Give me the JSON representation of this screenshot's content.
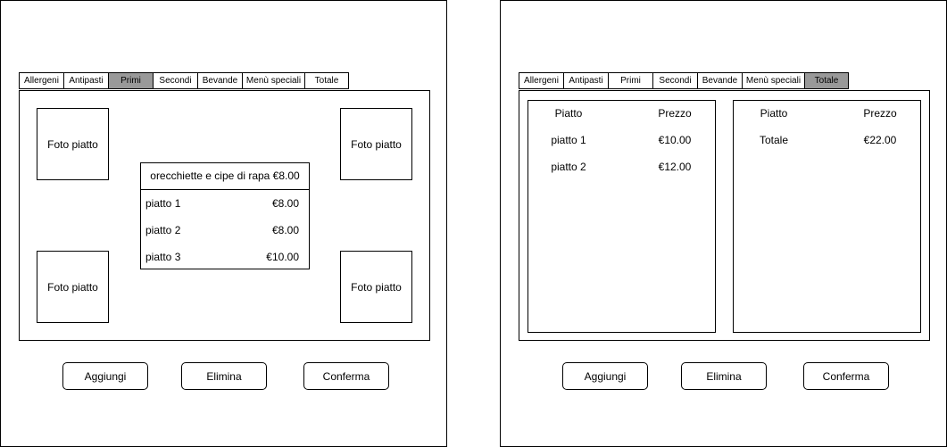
{
  "tabs": [
    "Allergeni",
    "Antipasti",
    "Primi",
    "Secondi",
    "Bevande",
    "Menù speciali",
    "Totale"
  ],
  "left_screen": {
    "active_tab": "Primi",
    "photo_label": "Foto piatto",
    "dish_header": "orecchiette e cipe di rapa €8.00",
    "dishes": [
      {
        "name": "piatto 1",
        "price": "€8.00"
      },
      {
        "name": "piatto 2",
        "price": "€8.00"
      },
      {
        "name": "piatto 3",
        "price": "€10.00"
      }
    ]
  },
  "right_screen": {
    "active_tab": "Totale",
    "order_list": {
      "col_dish": "Piatto",
      "col_price": "Prezzo",
      "rows": [
        {
          "name": "piatto 1",
          "price": "€10.00"
        },
        {
          "name": "piatto 2",
          "price": "€12.00"
        }
      ]
    },
    "total_box": {
      "col_dish": "Piatto",
      "col_price": "Prezzo",
      "label": "Totale",
      "value": "€22.00"
    }
  },
  "buttons": {
    "add": "Aggiungi",
    "delete": "Elimina",
    "confirm": "Conferma"
  }
}
